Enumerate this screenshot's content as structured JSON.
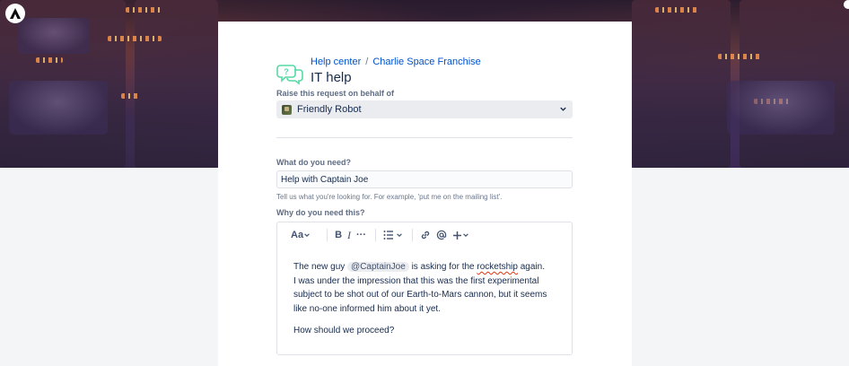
{
  "brand": {
    "logo_icon": "atlassian-logo-icon"
  },
  "breadcrumb": {
    "items": [
      "Help center",
      "Charlie Space Franchise"
    ],
    "separator": "/"
  },
  "page": {
    "title": "IT help",
    "icon": "help-chat-icon"
  },
  "on_behalf": {
    "label": "Raise this request on behalf of",
    "selected": "Friendly Robot",
    "avatar_icon": "user-avatar-icon",
    "chevron_icon": "chevron-down-icon"
  },
  "need": {
    "label": "What do you need?",
    "value": "Help with Captain Joe",
    "helper": "Tell us what you're looking for. For example, 'put me on the mailing list'."
  },
  "why": {
    "label": "Why do you need this?",
    "toolbar": {
      "text_style": "Aa",
      "bold": "B",
      "italic": "I",
      "more": "···"
    },
    "body": {
      "pre_mention": "The new guy ",
      "mention": "@CaptainJoe",
      "post_mention": " is asking for the ",
      "misspelled": "rocketship",
      "post_misspelled": " again.",
      "rest": "I was under the impression that this was the first experimental subject to be shot out of our Earth-to-Mars cannon, but it seems like no-one informed him about it yet.",
      "paragraph2": "How should we proceed?"
    }
  },
  "colors": {
    "link": "#0052cc",
    "help_icon": "#57d9a3",
    "text": "#172b4d",
    "label": "#5e6c84",
    "spellcheck": "#de350b"
  }
}
